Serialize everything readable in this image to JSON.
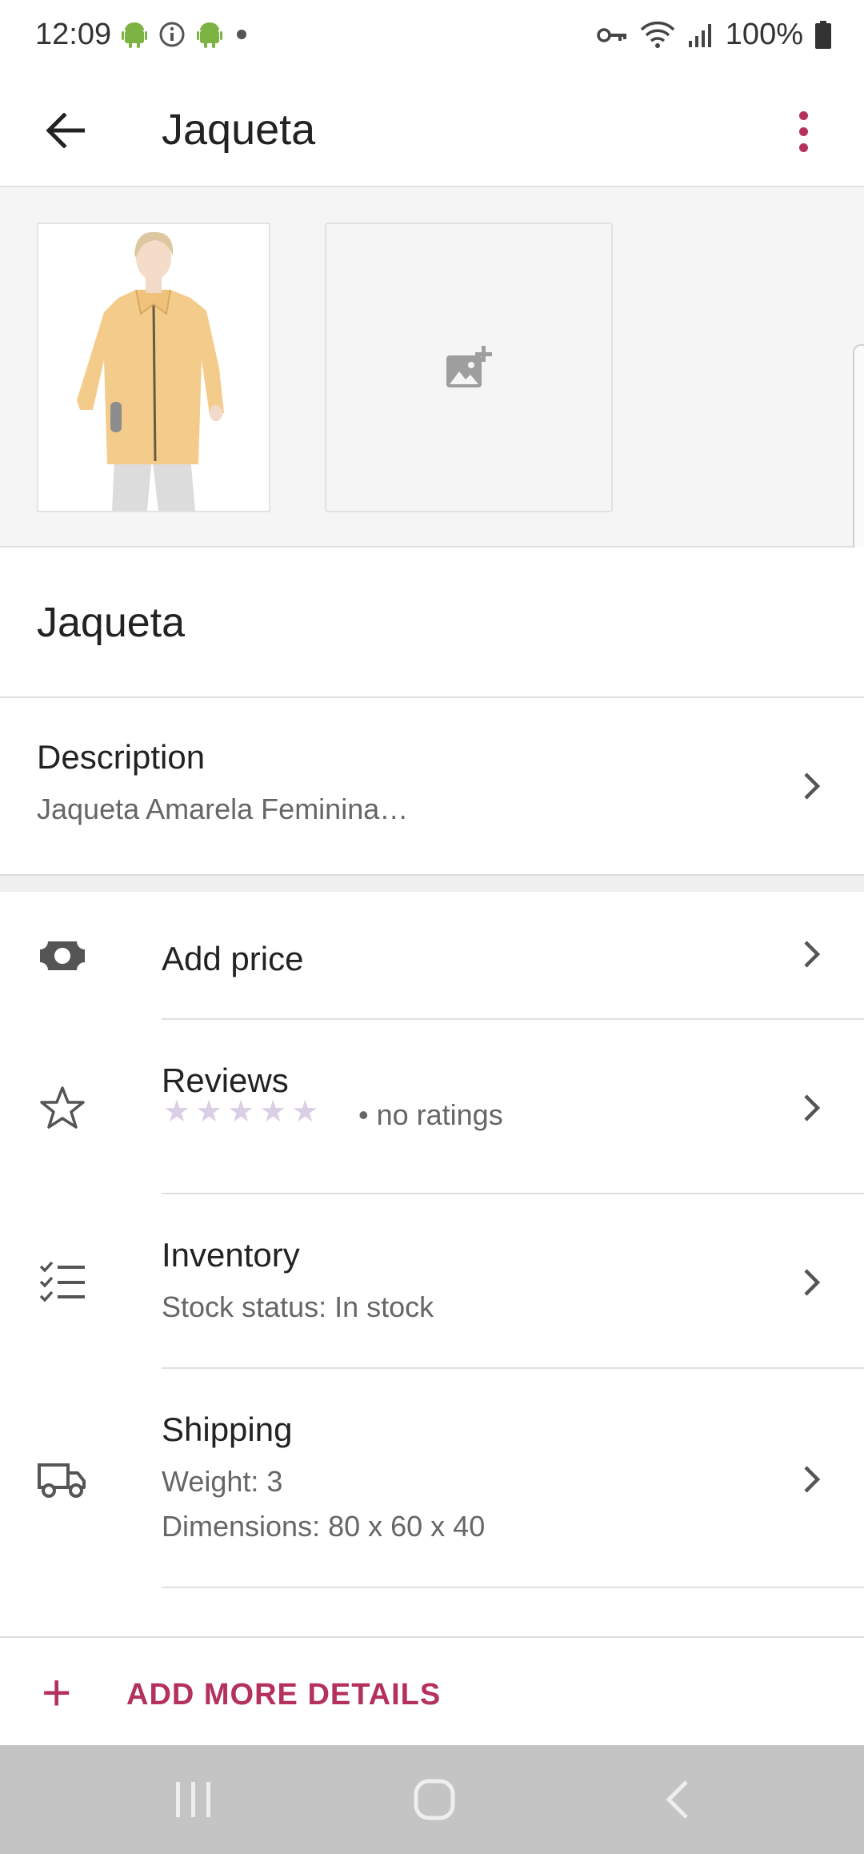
{
  "status_bar": {
    "time": "12:09",
    "battery": "100%",
    "icons_left": [
      "android-icon",
      "info-icon",
      "android-icon",
      "dot-icon"
    ],
    "icons_right": [
      "vpn-key-icon",
      "wifi-icon",
      "signal-icon",
      "battery-icon"
    ]
  },
  "app_bar": {
    "title": "Jaqueta",
    "back_icon": "arrow-back-icon",
    "menu_icon": "more-vert-icon"
  },
  "gallery": {
    "images": [
      "product-photo"
    ],
    "add_image_icon": "add-photo-icon"
  },
  "product": {
    "name": "Jaqueta"
  },
  "description": {
    "title": "Description",
    "text": "Jaqueta Amarela Feminina…"
  },
  "details": {
    "price": {
      "title": "Add price",
      "icon": "money-icon"
    },
    "reviews": {
      "title": "Reviews",
      "rating_text": "• no ratings",
      "stars": 5,
      "icon": "star-outline-icon"
    },
    "inventory": {
      "title": "Inventory",
      "subtitle": "Stock status: In stock",
      "icon": "checklist-icon"
    },
    "shipping": {
      "title": "Shipping",
      "weight": "Weight: 3",
      "dimensions": "Dimensions: 80 x 60 x 40",
      "icon": "truck-icon"
    }
  },
  "add_more": {
    "label": "ADD MORE DETAILS",
    "plus": "+"
  },
  "colors": {
    "accent": "#b3305f",
    "icon_gray": "#555555",
    "star_placeholder": "#d9d0e6"
  }
}
